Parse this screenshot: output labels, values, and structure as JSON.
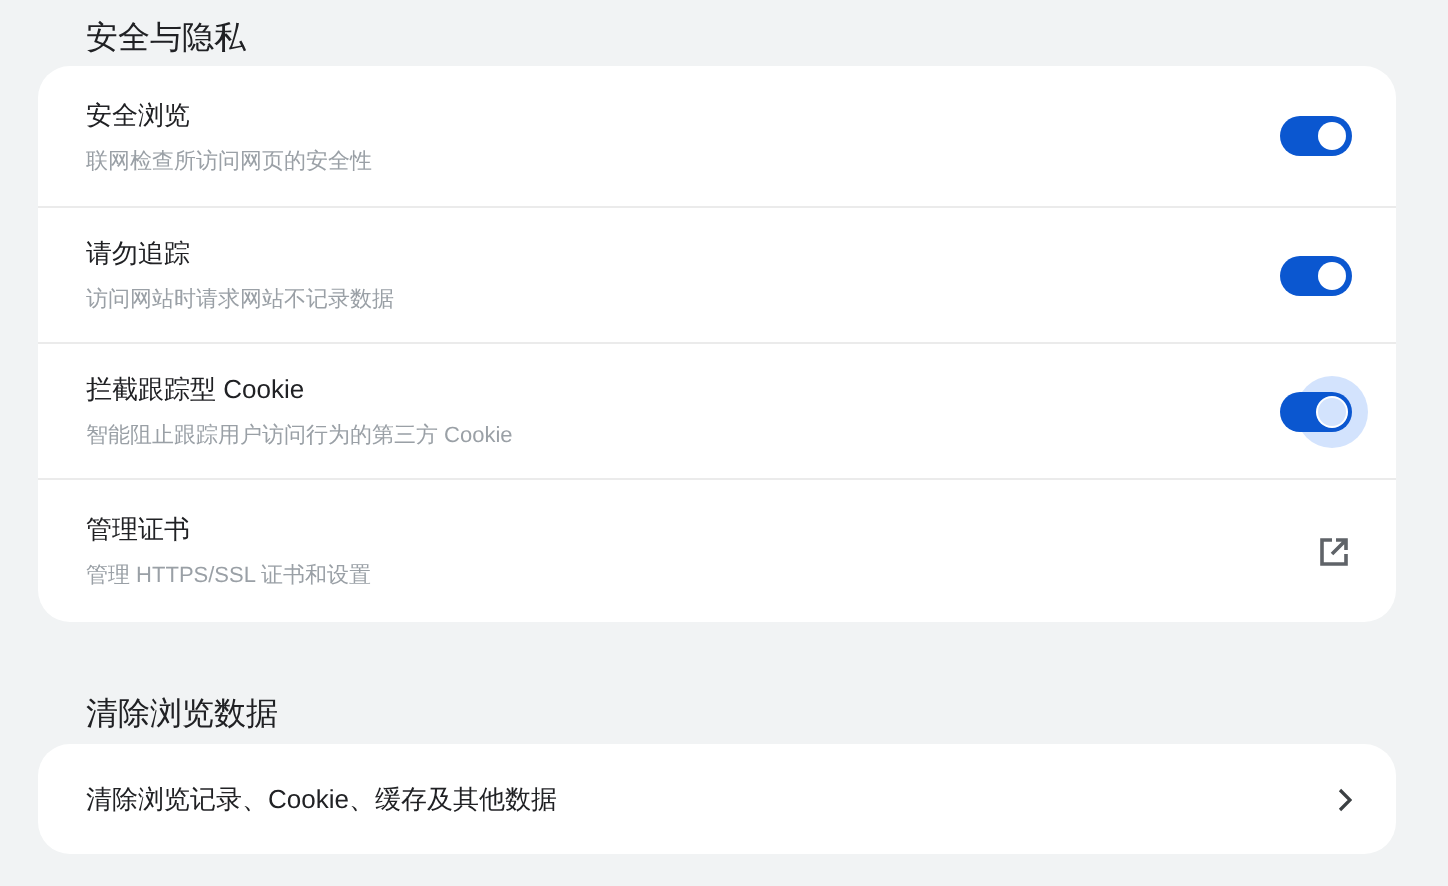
{
  "sections": [
    {
      "title": "安全与隐私",
      "rows": [
        {
          "kind": "toggle",
          "label": "安全浏览",
          "description": "联网检查所访问网页的安全性",
          "on": true,
          "focused": false
        },
        {
          "kind": "toggle",
          "label": "请勿追踪",
          "description": "访问网站时请求网站不记录数据",
          "on": true,
          "focused": false
        },
        {
          "kind": "toggle",
          "label": "拦截跟踪型 Cookie",
          "description": "智能阻止跟踪用户访问行为的第三方 Cookie",
          "on": true,
          "focused": true
        },
        {
          "kind": "external",
          "label": "管理证书",
          "description": "管理 HTTPS/SSL 证书和设置"
        }
      ]
    },
    {
      "title": "清除浏览数据",
      "rows": [
        {
          "kind": "chevron",
          "label": "清除浏览记录、Cookie、缓存及其他数据"
        }
      ]
    }
  ]
}
